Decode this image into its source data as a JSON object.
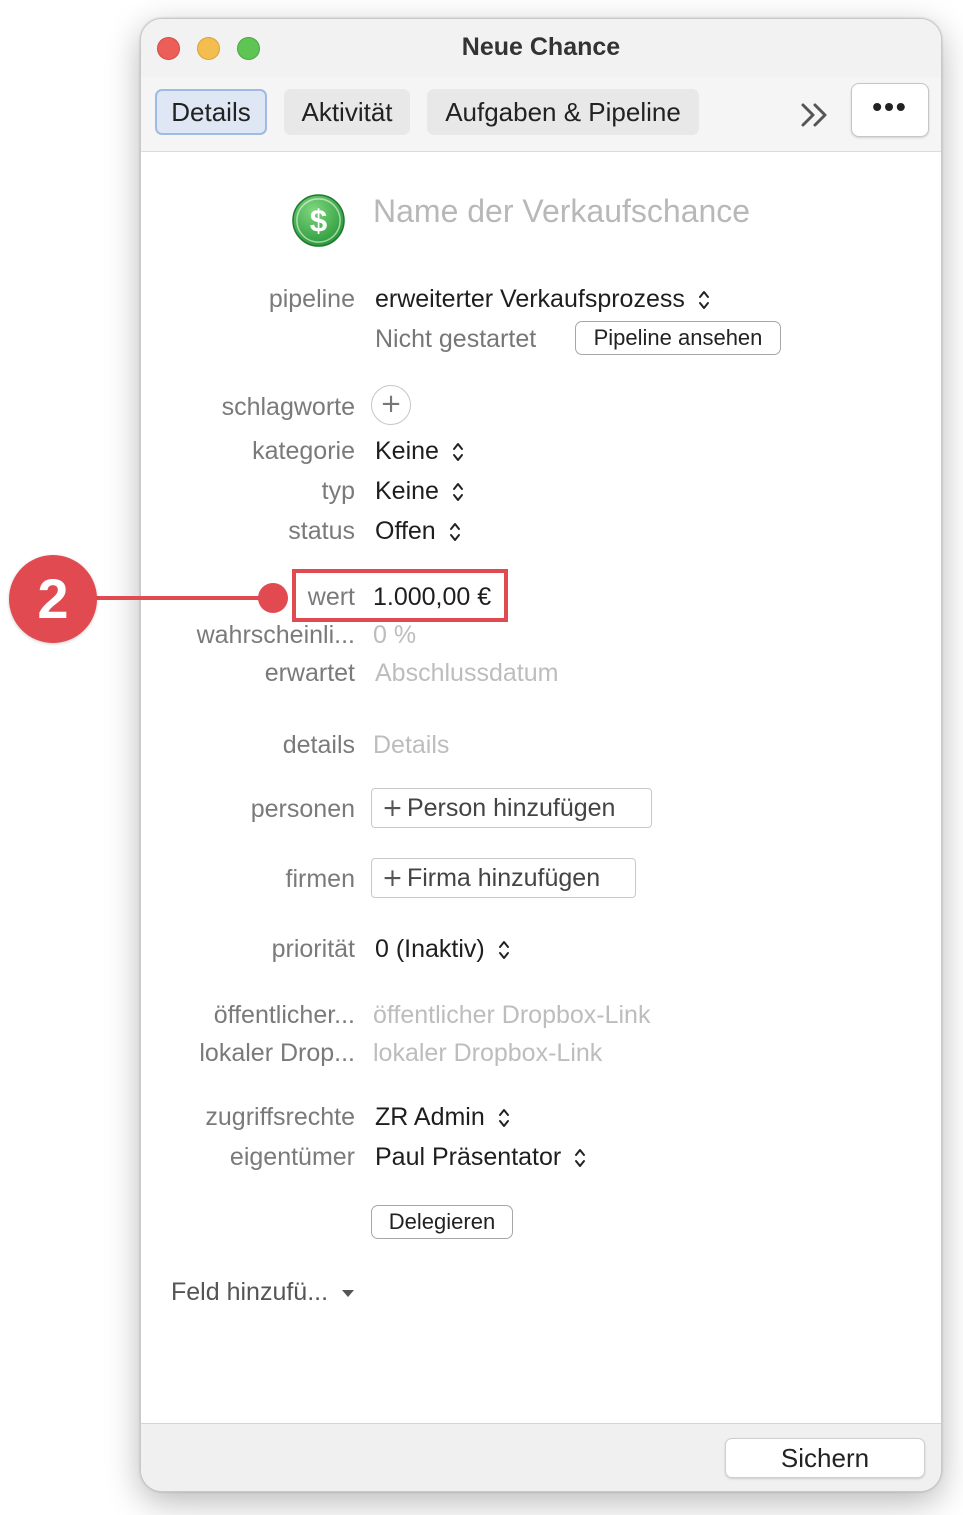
{
  "window": {
    "title": "Neue Chance"
  },
  "toolbar": {
    "tabs": [
      {
        "label": "Details",
        "active": true
      },
      {
        "label": "Aktivität",
        "active": false
      },
      {
        "label": "Aufgaben & Pipeline",
        "active": false
      }
    ],
    "overflow_icon": "chevron-double-right-icon",
    "more_label": "•••"
  },
  "header": {
    "icon": "dollar-icon",
    "name_placeholder": "Name der Verkaufschance"
  },
  "fields": {
    "pipeline": {
      "label": "pipeline",
      "value": "erweiterter Verkaufsprozess",
      "status": "Nicht gestartet",
      "button": "Pipeline ansehen"
    },
    "schlagworte": {
      "label": "schlagworte"
    },
    "kategorie": {
      "label": "kategorie",
      "value": "Keine"
    },
    "typ": {
      "label": "typ",
      "value": "Keine"
    },
    "status": {
      "label": "status",
      "value": "Offen"
    },
    "wert": {
      "label": "wert",
      "value": "1.000,00 €"
    },
    "wahrscheinlichkeit": {
      "label": "wahrscheinli...",
      "value": "0 %"
    },
    "erwartet": {
      "label": "erwartet",
      "placeholder": "Abschlussdatum"
    },
    "details": {
      "label": "details",
      "placeholder": "Details"
    },
    "personen": {
      "label": "personen",
      "button": "Person hinzufügen"
    },
    "firmen": {
      "label": "firmen",
      "button": "Firma hinzufügen"
    },
    "prioritaet": {
      "label": "priorität",
      "value": "0 (Inaktiv)"
    },
    "oeffentlicher_link": {
      "label": "öffentlicher...",
      "placeholder": "öffentlicher Dropbox-Link"
    },
    "lokaler_link": {
      "label": "lokaler Drop...",
      "placeholder": "lokaler Dropbox-Link"
    },
    "zugriffsrechte": {
      "label": "zugriffsrechte",
      "value": "ZR Admin"
    },
    "eigentuemer": {
      "label": "eigentümer",
      "value": "Paul Präsentator"
    },
    "delegate_button": "Delegieren",
    "add_field": "Feld hinzufü..."
  },
  "footer": {
    "save_label": "Sichern"
  },
  "annotation": {
    "number": "2",
    "color": "#e04a50"
  },
  "colors": {
    "accent": "#e04a50",
    "active_tab_bg": "#dfe7f5",
    "active_tab_border": "#9fbbe4",
    "icon_green": "#3aa84a"
  }
}
